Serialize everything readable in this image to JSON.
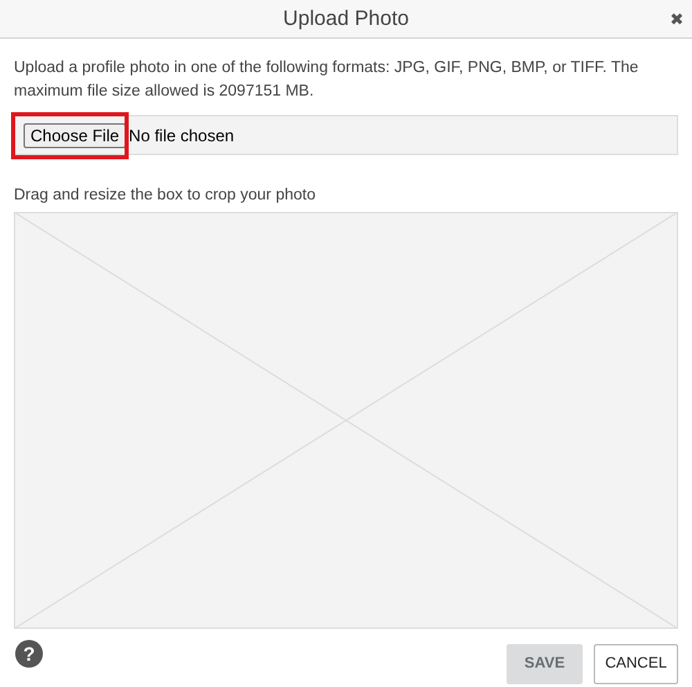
{
  "dialog": {
    "title": "Upload Photo",
    "close": "✖"
  },
  "instructions": "Upload a profile photo in one of the following formats: JPG, GIF, PNG, BMP, or TIFF. The maximum file size allowed is 2097151 MB.",
  "file_input": {
    "button": "Choose File",
    "status": "No file chosen",
    "highlighted": true
  },
  "crop_label": "Drag and resize the box to crop your photo",
  "footer": {
    "help": "?",
    "buttons": [
      {
        "label": "SAVE",
        "disabled": true
      },
      {
        "label": "CANCEL",
        "disabled": false
      }
    ]
  }
}
